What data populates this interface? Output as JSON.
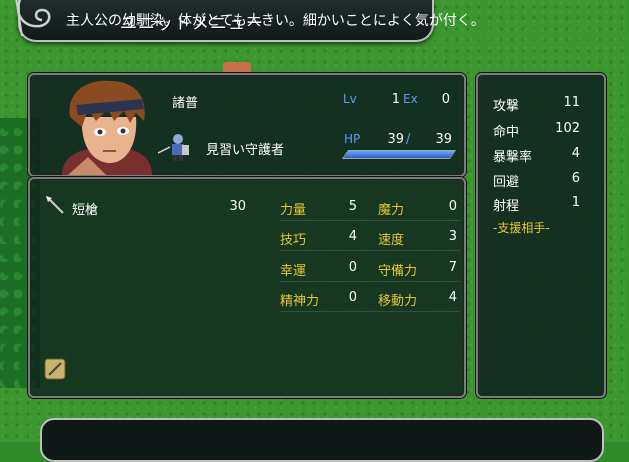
{
  "title": "ユニットメニュー",
  "unit": {
    "name": "諸普",
    "class": "見習い守護者",
    "lv_label": "Lv",
    "lv": "1",
    "ex_label": "Ex",
    "ex": "0",
    "hp_label": "HP",
    "hp_current": "39",
    "hp_sep": "/",
    "hp_max": "39",
    "hp_fraction": 1.0
  },
  "weapon": {
    "name": "短槍",
    "uses": "30"
  },
  "stats": [
    {
      "label": "力量",
      "value": "5"
    },
    {
      "label": "魔力",
      "value": "0"
    },
    {
      "label": "技巧",
      "value": "4"
    },
    {
      "label": "速度",
      "value": "3"
    },
    {
      "label": "幸運",
      "value": "0"
    },
    {
      "label": "守備力",
      "value": "7"
    },
    {
      "label": "精神力",
      "value": "0"
    },
    {
      "label": "移動力",
      "value": "4"
    }
  ],
  "combat": [
    {
      "label": "攻撃",
      "value": "11"
    },
    {
      "label": "命中",
      "value": "102"
    },
    {
      "label": "暴撃率",
      "value": "4"
    },
    {
      "label": "回避",
      "value": "6"
    },
    {
      "label": "射程",
      "value": "1"
    }
  ],
  "support_label": "-支援相手-",
  "description": "主人公の幼馴染。体がとても大きい。細かいことによく気が付く。",
  "colors": {
    "label_yellow": "#e8c531",
    "label_blue": "#5b9cff",
    "panel": "#0e201e"
  }
}
